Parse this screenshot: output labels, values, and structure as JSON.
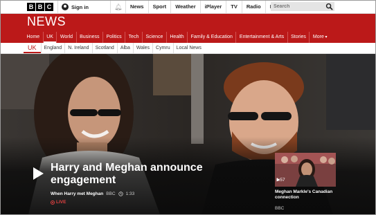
{
  "topbar": {
    "logo_letters": [
      "B",
      "B",
      "C"
    ],
    "sign_in": "Sign in",
    "nav": [
      "News",
      "Sport",
      "Weather",
      "iPlayer",
      "TV",
      "Radio",
      "More"
    ],
    "search_placeholder": "Search"
  },
  "header": {
    "title": "NEWS",
    "sections": [
      "Home",
      "UK",
      "World",
      "Business",
      "Politics",
      "Tech",
      "Science",
      "Health",
      "Family & Education",
      "Entertainment & Arts",
      "Stories",
      "More"
    ],
    "active_section": "UK"
  },
  "subnav": {
    "items": [
      "UK",
      "England",
      "N. Ireland",
      "Scotland",
      "Alba",
      "Wales",
      "Cymru",
      "Local News"
    ]
  },
  "hero": {
    "headline": "Harry and Meghan announce engagement",
    "show": "When Harry met Meghan",
    "source": "BBC",
    "duration": "1:33",
    "live": "LIVE"
  },
  "related": {
    "duration": "1:57",
    "title": "Meghan Markle's Canadian connection",
    "source": "BBC"
  },
  "colors": {
    "brand_red": "#bb1919",
    "live_red": "#e04040"
  }
}
